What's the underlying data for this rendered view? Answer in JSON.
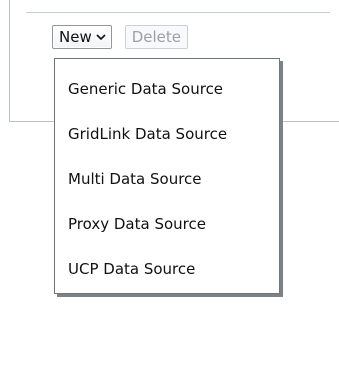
{
  "toolbar": {
    "new_label": "New",
    "delete_label": "Delete"
  },
  "menu": {
    "items": [
      {
        "label": "Generic Data Source"
      },
      {
        "label": "GridLink Data Source"
      },
      {
        "label": "Multi Data Source"
      },
      {
        "label": "Proxy Data Source"
      },
      {
        "label": "UCP Data Source"
      }
    ]
  },
  "icons": {
    "new_dropdown": "chevron-down-icon"
  }
}
